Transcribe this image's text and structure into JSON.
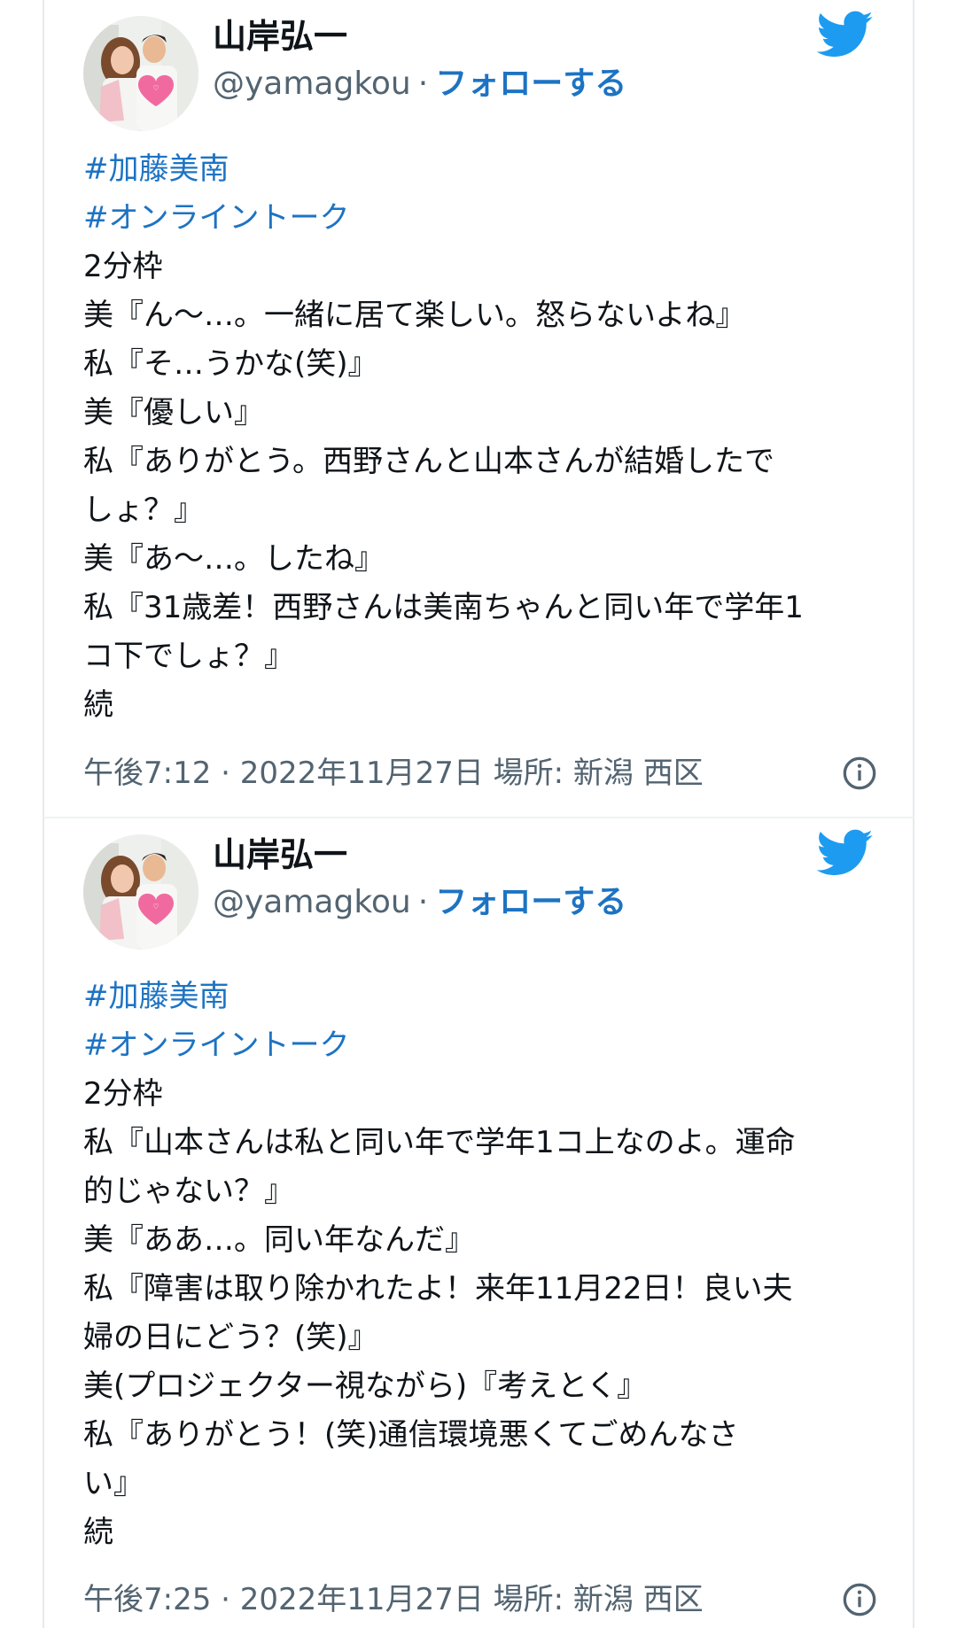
{
  "colors": {
    "link": "#1d73c3",
    "text": "#0f1419",
    "muted": "#536471",
    "twitter_blue": "#1d9bf0"
  },
  "tweets": [
    {
      "author_name": "山岸弘一",
      "handle": "@yamagkou",
      "separator": "·",
      "follow_label": "フォローする",
      "hashtags": [
        "#加藤美南",
        "#オンライントーク"
      ],
      "lines": [
        "2分枠",
        "美『ん〜…。一緒に居て楽しい。怒らないよね』",
        "私『そ…うかな(笑)』",
        "美『優しい』",
        "私『ありがとう。西野さんと山本さんが結婚したで",
        "しょ？』",
        "美『あ〜…。したね』",
        "私『31歳差！西野さんは美南ちゃんと同い年で学年1",
        "コ下でしょ？』",
        "続"
      ],
      "footer": "午後7:12 · 2022年11月27日 場所: 新潟 西区",
      "icons": {
        "brand": "twitter-bird-icon",
        "info": "info-icon"
      }
    },
    {
      "author_name": "山岸弘一",
      "handle": "@yamagkou",
      "separator": "·",
      "follow_label": "フォローする",
      "hashtags": [
        "#加藤美南",
        "#オンライントーク"
      ],
      "lines": [
        "2分枠",
        "私『山本さんは私と同い年で学年1コ上なのよ。運命",
        "的じゃない？』",
        "美『ああ…。同い年なんだ』",
        "私『障害は取り除かれたよ！来年11月22日！良い夫",
        "婦の日にどう？(笑)』",
        "美(プロジェクター視ながら)『考えとく』",
        "私『ありがとう！(笑)通信環境悪くてごめんなさ",
        "い』",
        "続"
      ],
      "footer": "午後7:25 · 2022年11月27日 場所: 新潟 西区",
      "icons": {
        "brand": "twitter-bird-icon",
        "info": "info-icon"
      }
    }
  ]
}
